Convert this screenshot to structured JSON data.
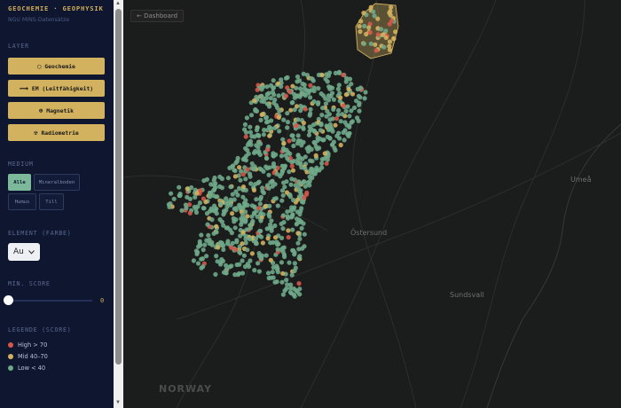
{
  "sidebar": {
    "title": "GEOCHEMIE · GEOPHYSIK",
    "subtitle": "NGU MINS-Datensätze",
    "layer_heading": "LAYER",
    "layers": [
      {
        "icon": "◯",
        "label": "Geochemie"
      },
      {
        "icon": "⟿",
        "label": "EM (Leitfähigkeit)"
      },
      {
        "icon": "⊕",
        "label": "Magnetik"
      },
      {
        "icon": "☢",
        "label": "Radiometrie"
      }
    ],
    "medium_heading": "MEDIUM",
    "medium": [
      "Alle",
      "Mineralboden",
      "Humus",
      "Till"
    ],
    "medium_selected": "Alle",
    "element_heading": "ELEMENT (FARBE)",
    "element_value": "Au",
    "score_heading": "MIN. SCORE",
    "score_value": "0",
    "score_fraction": 0,
    "legend_heading": "LEGENDE (SCORE)",
    "legend": [
      {
        "label": "High > 70",
        "color": "#d3584a"
      },
      {
        "label": "Mid 40–70",
        "color": "#d2b15f"
      },
      {
        "label": "Low < 40",
        "color": "#6fa989"
      }
    ]
  },
  "map": {
    "back_link": "← Dashboard",
    "places": [
      "Umeå",
      "Östersund",
      "Sundsvall",
      "NORWAY"
    ]
  }
}
